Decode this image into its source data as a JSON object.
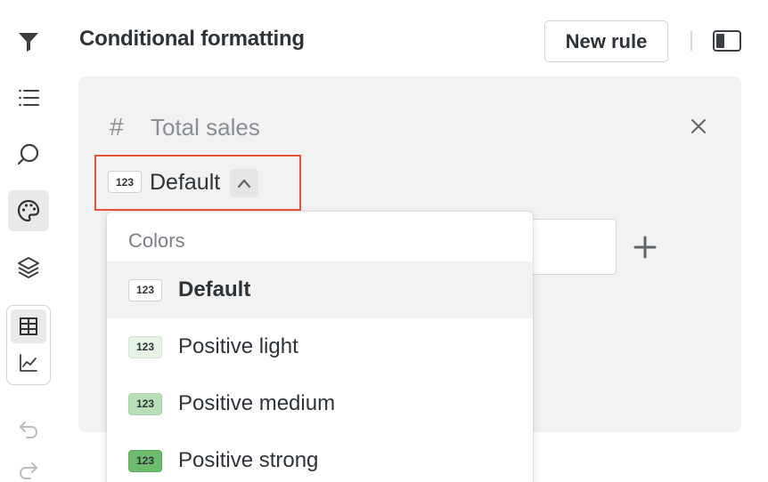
{
  "header": {
    "title": "Conditional formatting",
    "new_rule_label": "New rule"
  },
  "rule": {
    "field_symbol": "#",
    "field_name": "Total sales",
    "color_style": {
      "badge_text": "123",
      "selected_label": "Default"
    }
  },
  "dropdown": {
    "header": "Colors",
    "items": [
      {
        "badge_text": "123",
        "label": "Default",
        "badge_bg": "#ffffff",
        "badge_border": "#cfd1d4",
        "selected": true
      },
      {
        "badge_text": "123",
        "label": "Positive light",
        "badge_bg": "#e6f4e6",
        "badge_border": "#cfe3cf",
        "selected": false
      },
      {
        "badge_text": "123",
        "label": "Positive medium",
        "badge_bg": "#b9dfb9",
        "badge_border": "#a9d2a9",
        "selected": false
      },
      {
        "badge_text": "123",
        "label": "Positive strong",
        "badge_bg": "#6dbb6d",
        "badge_border": "#5aa95a",
        "selected": false
      }
    ]
  },
  "colors": {
    "highlight_border": "#e8533a",
    "card_bg": "#f2f2f3",
    "text": "#2e3338",
    "muted": "#8a8f95"
  },
  "icons": {
    "rail": [
      "filter-icon",
      "list-icon",
      "search-icon",
      "palette-icon",
      "layers-icon",
      "table-icon",
      "line-chart-icon",
      "undo-icon",
      "redo-icon"
    ]
  }
}
